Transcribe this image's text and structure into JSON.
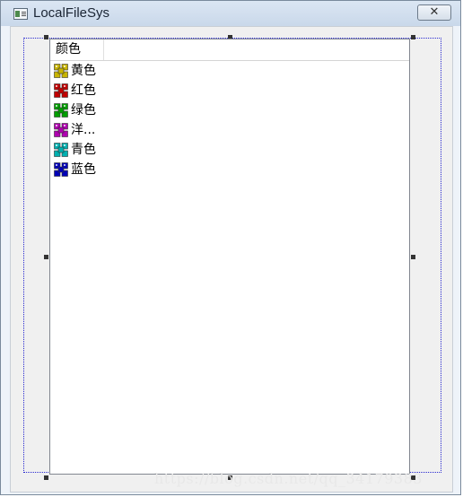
{
  "window": {
    "title": "LocalFileSys",
    "close_glyph": "✕"
  },
  "listview": {
    "column_header": "颜色",
    "items": [
      {
        "label": "黄色",
        "icon": "flower-icon",
        "color": "#c8b400"
      },
      {
        "label": "红色",
        "icon": "flower-icon",
        "color": "#c40000"
      },
      {
        "label": "绿色",
        "icon": "flower-icon",
        "color": "#00a000"
      },
      {
        "label": "洋...",
        "icon": "flower-icon",
        "color": "#b000b0"
      },
      {
        "label": "青色",
        "icon": "flower-icon",
        "color": "#00b0b0"
      },
      {
        "label": "蓝色",
        "icon": "flower-icon",
        "color": "#0000b8"
      }
    ]
  },
  "watermark": "https://blog.csdn.net/qq_34179383"
}
